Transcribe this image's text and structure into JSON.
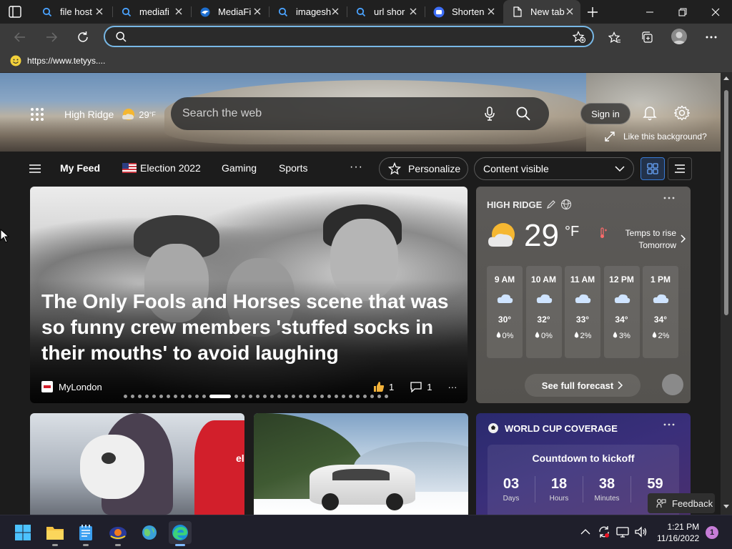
{
  "tabs": [
    {
      "label": "file host",
      "icon": "search-icon"
    },
    {
      "label": "mediafi",
      "icon": "search-icon"
    },
    {
      "label": "MediaFi",
      "icon": "mediafire-icon"
    },
    {
      "label": "imagesh",
      "icon": "search-icon"
    },
    {
      "label": "url shor",
      "icon": "search-icon"
    },
    {
      "label": "Shorten",
      "icon": "shortener-icon"
    },
    {
      "label": "New tab",
      "icon": "page-icon",
      "active": true
    }
  ],
  "address": {
    "value": "",
    "placeholder": ""
  },
  "favorites": [
    {
      "label": "https://www.tetyys....",
      "icon": "smiley-icon"
    }
  ],
  "header": {
    "location": "High Ridge",
    "temp": "29",
    "unit": "°F",
    "search_placeholder": "Search the web",
    "signin": "Sign in",
    "like_background": "Like this background?"
  },
  "feed_nav": {
    "items": [
      "My Feed",
      "Election 2022",
      "Gaming",
      "Sports"
    ],
    "more": "···",
    "personalize": "Personalize",
    "content_visible": "Content visible"
  },
  "main_story": {
    "title": "The Only Fools and Horses scene that was so funny crew members 'stuffed socks in their mouths' to avoid laughing",
    "source": "MyLondon",
    "likes": "1",
    "comments": "1",
    "more": "···",
    "carousel_count": 35,
    "carousel_active": 12
  },
  "weather": {
    "location": "HIGH RIDGE",
    "temp": "29",
    "unit": "°F",
    "alert_line1": "Temps to rise",
    "alert_line2": "Tomorrow",
    "hours": [
      {
        "time": "9 AM",
        "temp": "30°",
        "precip": "0%"
      },
      {
        "time": "10 AM",
        "temp": "32°",
        "precip": "0%"
      },
      {
        "time": "11 AM",
        "temp": "33°",
        "precip": "2%"
      },
      {
        "time": "12 PM",
        "temp": "34°",
        "precip": "3%"
      },
      {
        "time": "1 PM",
        "temp": "34°",
        "precip": "2%"
      }
    ],
    "full_forecast": "See full forecast"
  },
  "world_cup": {
    "title": "WORLD CUP COVERAGE",
    "countdown_title": "Countdown to kickoff",
    "cells": [
      {
        "num": "03",
        "label": "Days"
      },
      {
        "num": "18",
        "label": "Hours"
      },
      {
        "num": "38",
        "label": "Minutes"
      },
      {
        "num": "59",
        "label": "Se"
      }
    ]
  },
  "card1": {
    "badge": "el"
  },
  "feedback": "Feedback",
  "taskbar": {
    "time": "1:21 PM",
    "date": "11/16/2022",
    "notifications": "1"
  },
  "colors": {
    "accent": "#78b8e6",
    "tab_bg": "#202020",
    "toolbar_bg": "#3b3b3b",
    "taskbar_bg": "#1f1f2b",
    "weather_card": "#5c5a58",
    "worldcup_card": "#2a2a6e"
  }
}
